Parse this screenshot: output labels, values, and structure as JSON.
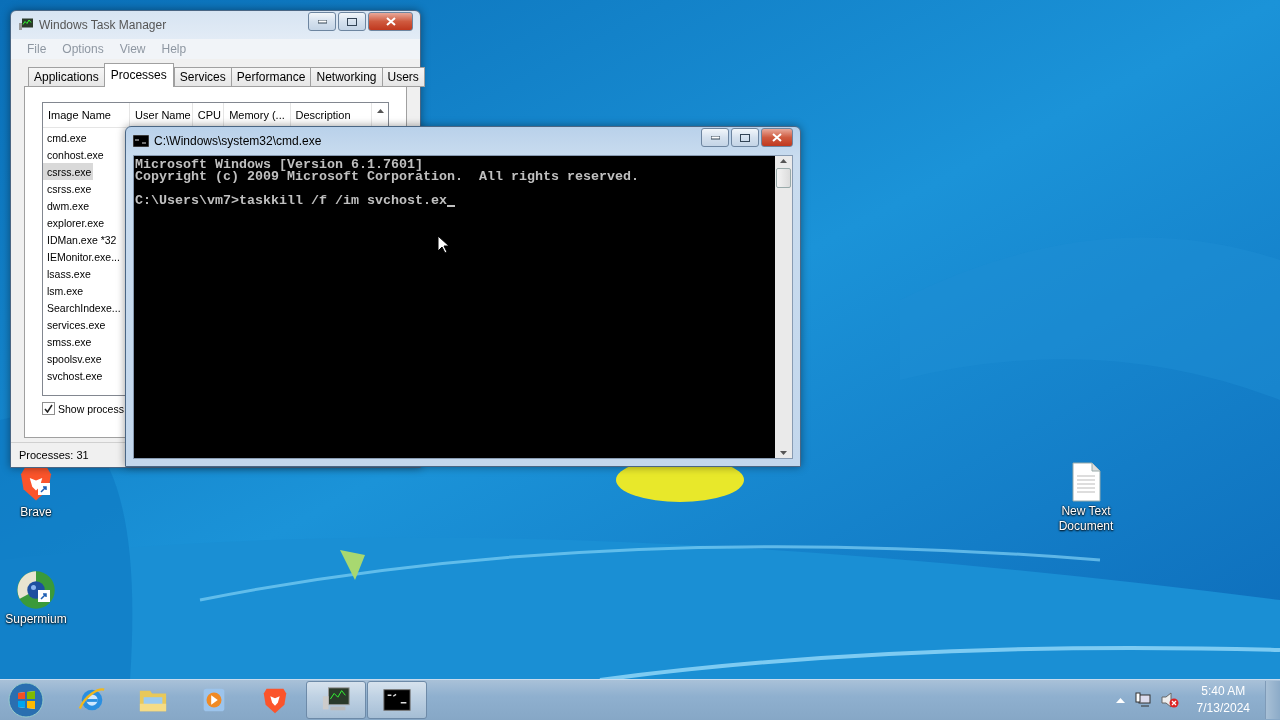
{
  "desktop_icons": [
    {
      "kind": "brave",
      "label": "Brave"
    },
    {
      "kind": "supermium",
      "label": "Supermium"
    },
    {
      "kind": "document",
      "label": "New Text Document"
    }
  ],
  "task_manager": {
    "title": "Windows Task Manager",
    "menu": [
      "File",
      "Options",
      "View",
      "Help"
    ],
    "tabs": [
      {
        "label": "Applications",
        "selected": false
      },
      {
        "label": "Processes",
        "selected": true
      },
      {
        "label": "Services",
        "selected": false
      },
      {
        "label": "Performance",
        "selected": false
      },
      {
        "label": "Networking",
        "selected": false
      },
      {
        "label": "Users",
        "selected": false
      }
    ],
    "columns": [
      "Image Name",
      "User Name",
      "CPU",
      "Memory (...",
      "Description"
    ],
    "rows": [
      {
        "name": "cmd.exe",
        "selected": false
      },
      {
        "name": "conhost.exe",
        "selected": false
      },
      {
        "name": "csrss.exe",
        "selected": true
      },
      {
        "name": "csrss.exe",
        "selected": false
      },
      {
        "name": "dwm.exe",
        "selected": false
      },
      {
        "name": "explorer.exe",
        "selected": false
      },
      {
        "name": "IDMan.exe *32",
        "selected": false
      },
      {
        "name": "IEMonitor.exe...",
        "selected": false
      },
      {
        "name": "lsass.exe",
        "selected": false
      },
      {
        "name": "lsm.exe",
        "selected": false
      },
      {
        "name": "SearchIndexe...",
        "selected": false
      },
      {
        "name": "services.exe",
        "selected": false
      },
      {
        "name": "smss.exe",
        "selected": false
      },
      {
        "name": "spoolsv.exe",
        "selected": false
      },
      {
        "name": "svchost.exe",
        "selected": false
      }
    ],
    "show_processes": {
      "label": "Show process",
      "checked": true
    },
    "status": "Processes: 31"
  },
  "console": {
    "title": "C:\\Windows\\system32\\cmd.exe",
    "lines": [
      {
        "kind": "output",
        "text": "Microsoft Windows [Version 6.1.7601]"
      },
      {
        "kind": "output",
        "text": "Copyright (c) 2009 Microsoft Corporation.  All rights reserved."
      },
      {
        "kind": "prompt",
        "text": "C:\\Users\\vm7>taskkill /f /im svchost.ex"
      }
    ]
  },
  "taskbar": {
    "items": [
      {
        "kind": "internet-explorer",
        "running": false
      },
      {
        "kind": "folder",
        "running": false
      },
      {
        "kind": "media-player",
        "running": false
      },
      {
        "kind": "brave",
        "running": false
      },
      {
        "kind": "task-manager",
        "running": true
      },
      {
        "kind": "console",
        "running": true
      }
    ],
    "time": "5:40 AM",
    "date": "7/13/2024"
  }
}
